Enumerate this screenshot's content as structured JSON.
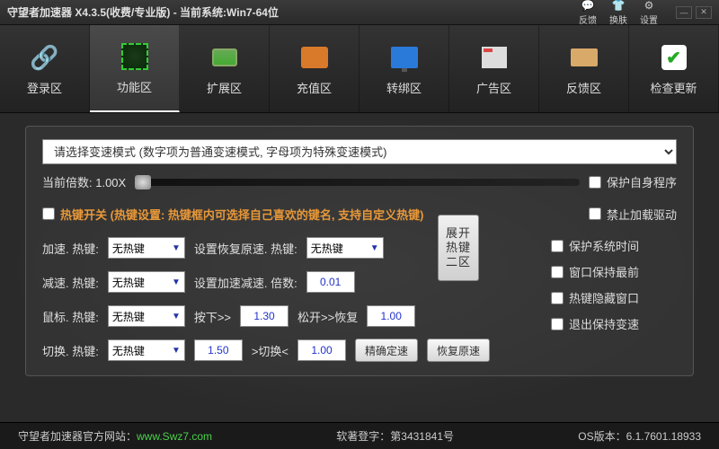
{
  "title": "守望者加速器 X4.3.5(收费/专业版) - 当前系统:Win7-64位",
  "titlebar_icons": {
    "feedback": "反馈",
    "skin": "换肤",
    "settings": "设置"
  },
  "tabs": {
    "login": "登录区",
    "func": "功能区",
    "ext": "扩展区",
    "pay": "充值区",
    "bind": "转绑区",
    "ad": "广告区",
    "fb": "反馈区",
    "upd": "检查更新"
  },
  "mode_placeholder": "请选择变速模式 (数字项为普通变速模式, 字母项为特殊变速模式)",
  "speed_label": "当前倍数: 1.00X",
  "hotkey_switch": "热键开关 (热键设置: 热键框内可选择自己喜欢的键名, 支持自定义热键)",
  "labels": {
    "accel": "加速. 热键:",
    "decel": "减速. 热键:",
    "mouse": "鼠标. 热键:",
    "switch": "切换. 热键:",
    "restore": "设置恢复原速. 热键:",
    "step": "设置加速减速. 倍数:",
    "press": "按下>>",
    "release": "松开>>恢复",
    "switch2": ">切换<"
  },
  "combo_none": "无热键",
  "values": {
    "step": "0.01",
    "press": "1.30",
    "release": "1.00",
    "sw1": "1.50",
    "sw2": "1.00"
  },
  "buttons": {
    "expand": "展开热键二区",
    "precise": "精确定速",
    "restore_orig": "恢复原速"
  },
  "checks": {
    "protect_self": "保护自身程序",
    "no_driver": "禁止加载驱动",
    "protect_time": "保护系统时间",
    "topmost": "窗口保持最前",
    "hide_hotkey": "热键隐藏窗口",
    "keep_on_exit": "退出保持变速"
  },
  "footer": {
    "site_label": "守望者加速器官方网站：",
    "site_url": "www.Swz7.com",
    "reg": "软著登字：第3431841号",
    "os": "OS版本：6.1.7601.18933"
  }
}
